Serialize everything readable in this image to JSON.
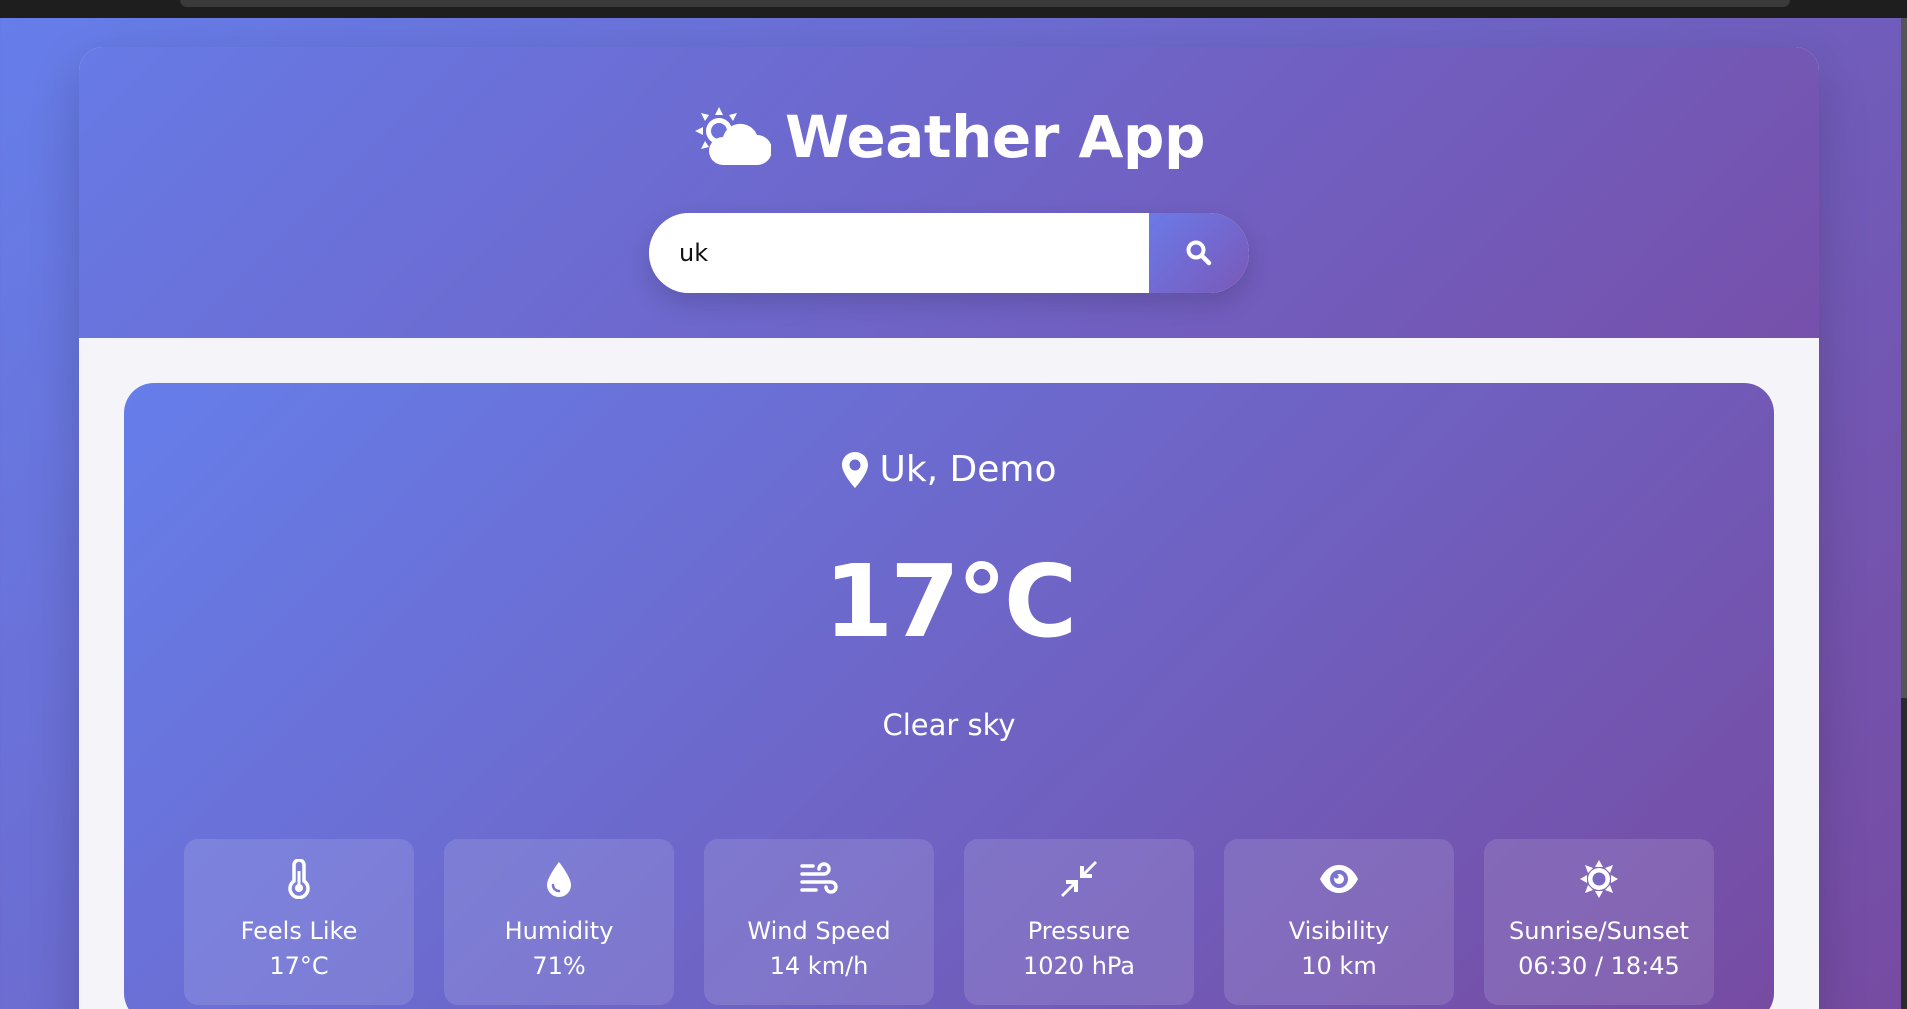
{
  "app": {
    "title": "Weather App",
    "icon": "sun-cloud-icon",
    "colors": {
      "gradient_start": "#667eea",
      "gradient_end": "#764ba2",
      "panel_background": "#f5f4f8",
      "text": "#ffffff"
    }
  },
  "search": {
    "value": "uk",
    "button_icon": "search-icon"
  },
  "weather": {
    "location_icon": "map-marker-icon",
    "location": "Uk, Demo",
    "temperature": "17°C",
    "description": "Clear sky",
    "details": [
      {
        "icon": "thermometer-icon",
        "label": "Feels Like",
        "value": "17°C"
      },
      {
        "icon": "water-drop-icon",
        "label": "Humidity",
        "value": "71%"
      },
      {
        "icon": "wind-icon",
        "label": "Wind Speed",
        "value": "14 km/h"
      },
      {
        "icon": "compress-arrows-icon",
        "label": "Pressure",
        "value": "1020 hPa"
      },
      {
        "icon": "eye-icon",
        "label": "Visibility",
        "value": "10 km"
      },
      {
        "icon": "sun-icon",
        "label": "Sunrise/Sunset",
        "value": "06:30 / 18:45"
      }
    ]
  }
}
